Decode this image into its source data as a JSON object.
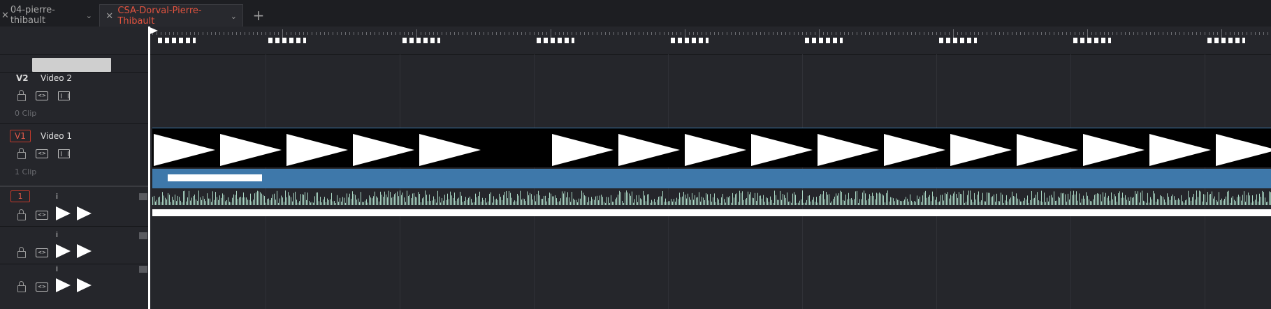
{
  "tabs": [
    {
      "label": "04-pierre-thibault",
      "active": false
    },
    {
      "label": "CSA-Dorval-Pierre-Thibault",
      "active": true
    }
  ],
  "add_tab_label": "+",
  "tracks": {
    "v2": {
      "badge": "V2",
      "name": "Video 2",
      "clip_count": "0 Clip"
    },
    "v1": {
      "badge": "V1",
      "name": "Video 1",
      "clip_count": "1 Clip"
    },
    "audio": [
      {
        "number": "1",
        "label": "i"
      },
      {
        "number": "",
        "label": "i"
      },
      {
        "number": "",
        "label": "i"
      }
    ]
  },
  "icons": {
    "lock": "lock-icon",
    "auto_select": "auto-select-icon",
    "monitor": "monitor-icon",
    "audio_play": "play-triangle-icon"
  },
  "colors": {
    "accent_red": "#e2533f",
    "clip_blue": "#3e78aa",
    "audio_wave": "#a9d6c3",
    "background": "#25262b"
  }
}
